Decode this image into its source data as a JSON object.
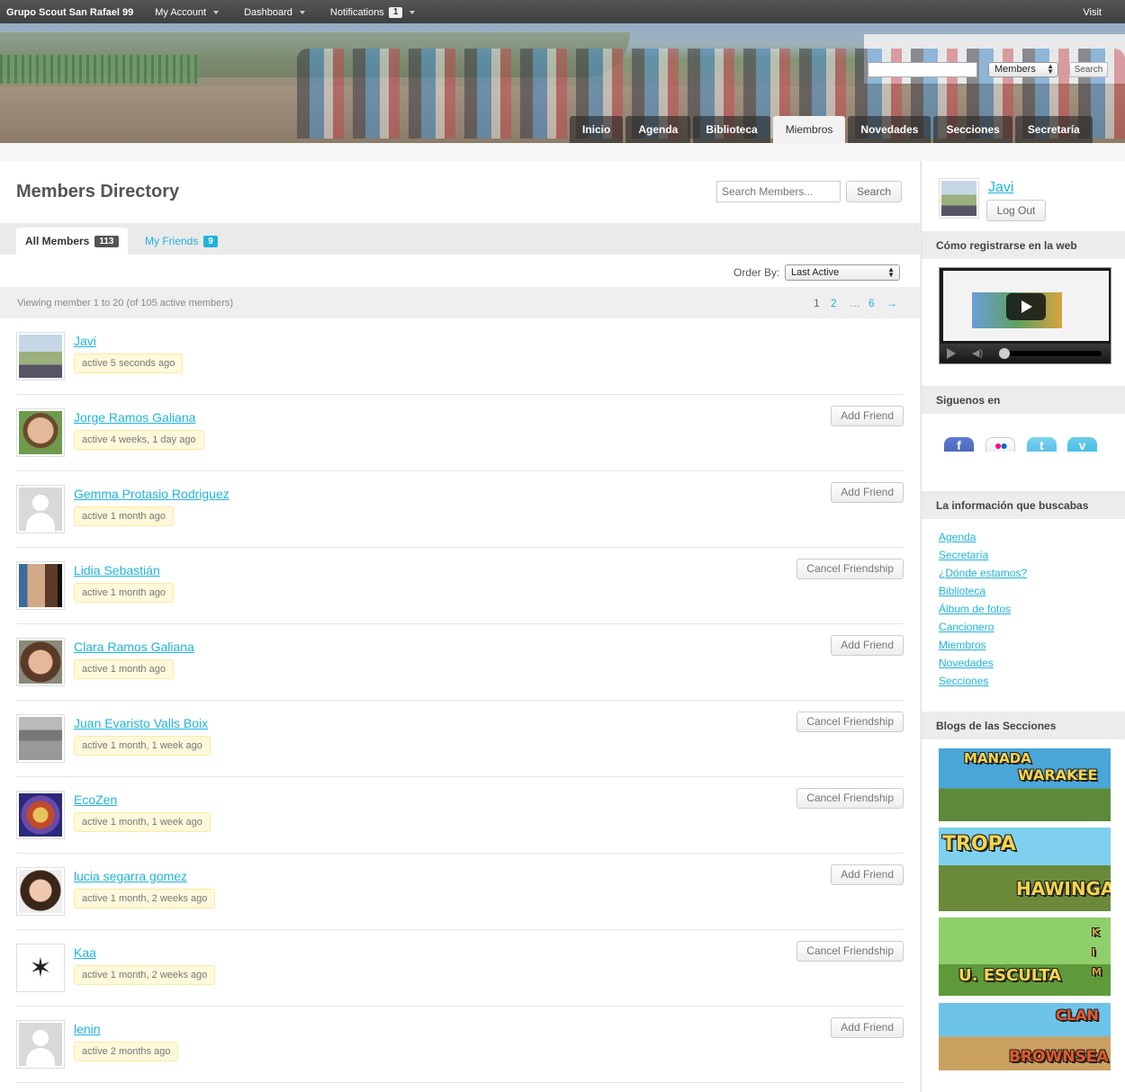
{
  "adminbar": {
    "site": "Grupo Scout San Rafael 99",
    "my_account": "My Account",
    "dashboard": "Dashboard",
    "notifications": "Notifications",
    "notifications_count": "1",
    "visit": "Visit"
  },
  "header": {
    "search_select": "Members",
    "search_button": "Search",
    "nav": [
      "Inicio",
      "Agenda",
      "Biblioteca",
      "Miembros",
      "Novedades",
      "Secciones",
      "Secretaría"
    ],
    "active_nav": "Miembros"
  },
  "main": {
    "title": "Members Directory",
    "search_placeholder": "Search Members...",
    "search_button": "Search",
    "tabs": [
      {
        "label": "All Members",
        "count": "113"
      },
      {
        "label": "My Friends",
        "count": "9"
      }
    ],
    "order_label": "Order By:",
    "order_value": "Last Active",
    "viewing": "Viewing member 1 to 20 (of 105 active members)",
    "pagination": [
      "1",
      "2",
      "…",
      "6",
      "→"
    ]
  },
  "members": [
    {
      "name": "Javi",
      "activity": "active 5 seconds ago",
      "action": ""
    },
    {
      "name": "Jorge Ramos Galiana",
      "activity": "active 4 weeks, 1 day ago",
      "action": "Add Friend"
    },
    {
      "name": "Gemma Protasio Rodriguez",
      "activity": "active 1 month ago",
      "action": "Add Friend"
    },
    {
      "name": "Lidia Sebastián",
      "activity": "active 1 month ago",
      "action": "Cancel Friendship"
    },
    {
      "name": "Clara Ramos Galiana",
      "activity": "active 1 month ago",
      "action": "Add Friend"
    },
    {
      "name": "Juan Evaristo Valls Boix",
      "activity": "active 1 month, 1 week ago",
      "action": "Cancel Friendship"
    },
    {
      "name": "EcoZen",
      "activity": "active 1 month, 1 week ago",
      "action": "Cancel Friendship"
    },
    {
      "name": "lucia segarra gomez",
      "activity": "active 1 month, 2 weeks ago",
      "action": "Add Friend"
    },
    {
      "name": "Kaa",
      "activity": "active 1 month, 2 weeks ago",
      "action": "Cancel Friendship"
    },
    {
      "name": "lenin",
      "activity": "active 2 months ago",
      "action": "Add Friend"
    }
  ],
  "sidebar": {
    "user_name": "Javi",
    "logout": "Log Out",
    "video_heading": "Cómo registrarse en la web",
    "social_heading": "Siguenos en",
    "social_icons": [
      "facebook-icon",
      "flickr-icon",
      "twitter-icon",
      "vimeo-icon"
    ],
    "info_heading": "La información que buscabas",
    "links": [
      "Agenda",
      "Secretaría",
      "¿Dónde estamos?",
      "Biblioteca",
      "Álbum de fotos",
      "Cancionero",
      "Miembros",
      "Novedades",
      "Secciones"
    ],
    "blogs_heading": "Blogs de las Secciones",
    "blogs": [
      {
        "line1": "MANADA",
        "line2": "WARAKEE"
      },
      {
        "line1": "TROPA",
        "line2": "HAWINGA"
      },
      {
        "line1": "U. ESCULTA",
        "line2": "KIM"
      },
      {
        "line1": "CLAN",
        "line2": "BROWNSEA"
      }
    ]
  },
  "colors": {
    "link": "#1fb3dd",
    "activity_bg": "#fff9db",
    "adminbar": "#464646"
  }
}
